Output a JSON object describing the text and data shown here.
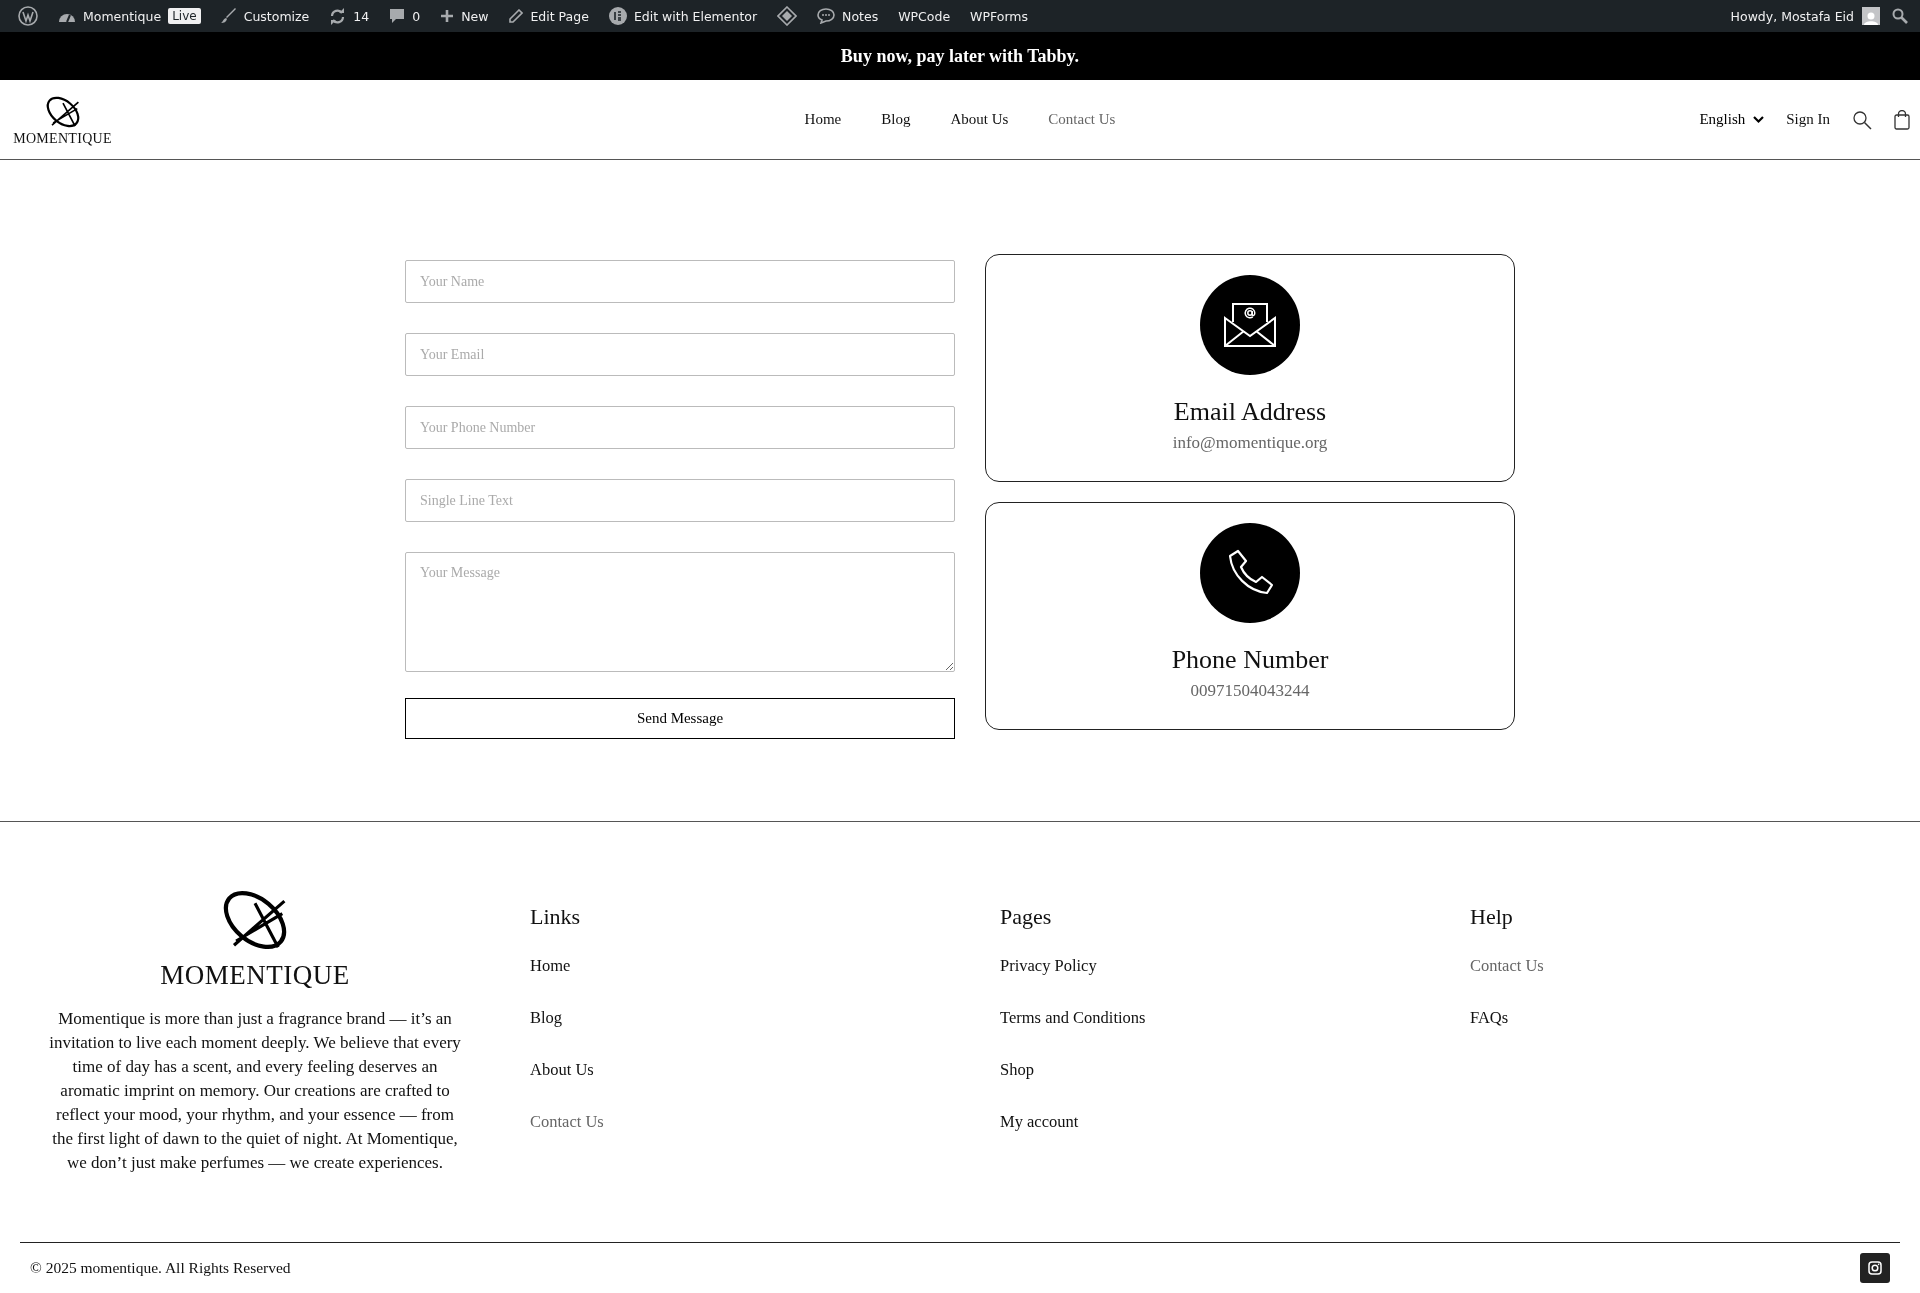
{
  "admin_bar": {
    "items": [
      {
        "kind": "wordpress"
      },
      {
        "kind": "site",
        "label": "Momentique",
        "badge": "Live"
      },
      {
        "kind": "brush",
        "label": "Customize"
      },
      {
        "kind": "updates",
        "label": "14"
      },
      {
        "kind": "comments",
        "label": "0"
      },
      {
        "kind": "new",
        "label": "New"
      },
      {
        "kind": "edit",
        "label": "Edit Page"
      },
      {
        "kind": "elementor",
        "label": "Edit with Elementor"
      },
      {
        "kind": "diamond"
      },
      {
        "kind": "notes",
        "label": "Notes"
      },
      {
        "kind": "plain",
        "label": "WPCode"
      },
      {
        "kind": "plain",
        "label": "WPForms"
      }
    ],
    "user": "Howdy, Mostafa Eid"
  },
  "promo_bar": {
    "text": "Buy now, pay later with Tabby."
  },
  "header": {
    "logo": "MOMENTIQUE",
    "nav": [
      {
        "label": "Home",
        "selected": false
      },
      {
        "label": "Blog",
        "selected": false
      },
      {
        "label": "About Us",
        "selected": false
      },
      {
        "label": "Contact Us",
        "selected": true
      }
    ],
    "language": "English",
    "sign_in": "Sign In"
  },
  "form": {
    "fields": [
      {
        "placeholder": "Your Name",
        "kind": "input"
      },
      {
        "placeholder": "Your Email",
        "kind": "input"
      },
      {
        "placeholder": "Your Phone Number",
        "kind": "input"
      },
      {
        "placeholder": "Single Line Text",
        "kind": "input"
      },
      {
        "placeholder": "Your Message",
        "kind": "textarea"
      }
    ],
    "submit": "Send Message"
  },
  "contact_cards": [
    {
      "kind": "email",
      "title": "Email Address",
      "value": "info@momentique.org"
    },
    {
      "kind": "phone",
      "title": "Phone Number",
      "value": "00971504043244"
    }
  ],
  "footer": {
    "logo": "MOMENTIQUE",
    "about": "Momentique is more than just a fragrance brand — it’s an invitation to live each moment deeply. We believe that every time of day has a scent, and every feeling deserves an aromatic imprint on memory. Our creations are crafted to reflect your mood, your rhythm, and your essence — from the first light of dawn to the quiet of night. At Momentique, we don’t just make perfumes — we create experiences.",
    "columns": [
      {
        "title": "Links",
        "items": [
          {
            "label": "Home",
            "selected": false
          },
          {
            "label": "Blog",
            "selected": false
          },
          {
            "label": "About Us",
            "selected": false
          },
          {
            "label": "Contact Us",
            "selected": true
          }
        ]
      },
      {
        "title": "Pages",
        "items": [
          {
            "label": "Privacy Policy",
            "selected": false
          },
          {
            "label": "Terms and Conditions",
            "selected": false
          },
          {
            "label": "Shop",
            "selected": false
          },
          {
            "label": "My account",
            "selected": false
          }
        ]
      },
      {
        "title": "Help",
        "items": [
          {
            "label": "Contact Us",
            "selected": true
          },
          {
            "label": "FAQs",
            "selected": false
          }
        ]
      }
    ],
    "copyright": "© 2025 momentique. All Rights Reserved"
  }
}
